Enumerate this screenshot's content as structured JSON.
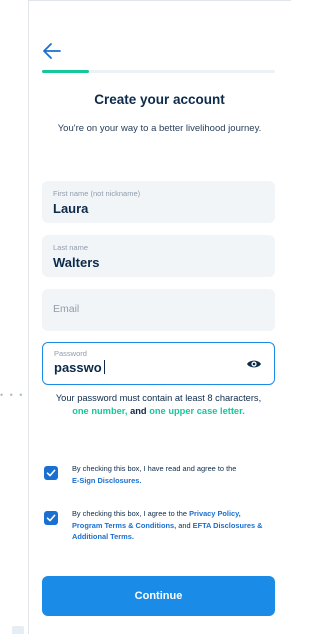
{
  "nav": {
    "back_icon": "arrow-left-icon",
    "progress_fraction": 0.2
  },
  "header": {
    "title": "Create your account",
    "subtitle": "You're on your way to a better livelihood journey."
  },
  "form": {
    "first_name": {
      "label": "First name (not nickname)",
      "value": "Laura"
    },
    "last_name": {
      "label": "Last name",
      "value": "Walters"
    },
    "email": {
      "placeholder": "Email"
    },
    "password": {
      "label": "Password",
      "value": "passwo",
      "toggle_icon": "eye-icon"
    }
  },
  "password_hint": {
    "prefix": "Your password must contain at least 8 characters,",
    "req_number": "one number,",
    "joiner": "and",
    "req_upper": "one upper case letter."
  },
  "consents": [
    {
      "text": "By checking this box, I have read and agree to the",
      "link1": "E-Sign Disclosures.",
      "checked": true
    },
    {
      "text": "By checking this box, I agree to the",
      "link1": "Privacy Policy,",
      "link2": "Program Terms & Conditions,",
      "joiner": "and",
      "link3": "EFTA Disclosures & Additional Terms.",
      "checked": true
    }
  ],
  "actions": {
    "continue_label": "Continue"
  },
  "colors": {
    "accent": "#1a8be6",
    "success": "#16c79a",
    "text": "#0c2a4a",
    "field_bg": "#f2f5f8"
  }
}
